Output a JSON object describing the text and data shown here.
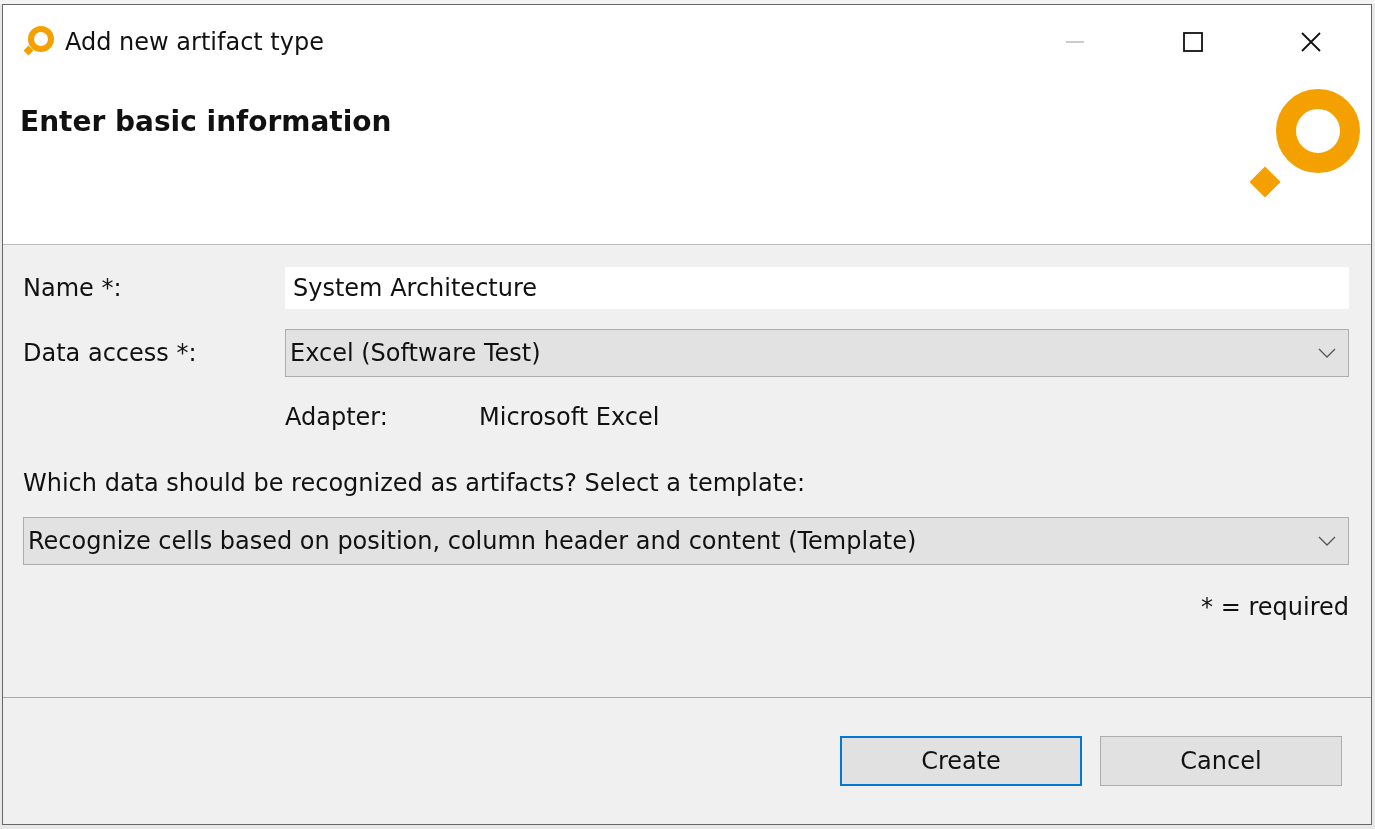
{
  "window": {
    "title": "Add new artifact type"
  },
  "header": {
    "title": "Enter basic information"
  },
  "form": {
    "name": {
      "label": "Name *:",
      "value": "System Architecture"
    },
    "data_access": {
      "label": "Data access *:",
      "value": "Excel (Software Test)"
    },
    "adapter": {
      "label": "Adapter:",
      "value": "Microsoft Excel"
    },
    "template_question": "Which data should be recognized as artifacts? Select a template:",
    "template": {
      "value": "Recognize cells based on position, column header and content (Template)"
    },
    "required_note": "* = required"
  },
  "buttons": [
    {
      "label": "Create",
      "default": true
    },
    {
      "label": "Cancel",
      "default": false
    }
  ]
}
